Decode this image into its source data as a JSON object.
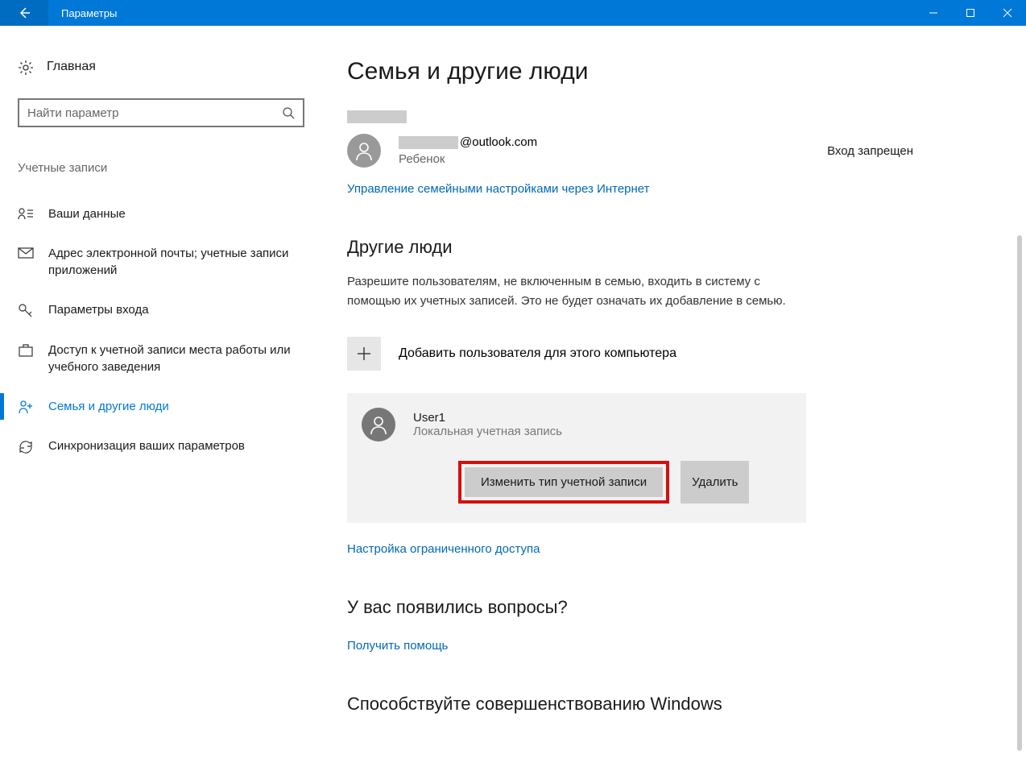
{
  "window": {
    "title": "Параметры"
  },
  "sidebar": {
    "home": "Главная",
    "search_placeholder": "Найти параметр",
    "section_label": "Учетные записи",
    "items": [
      {
        "label": "Ваши данные"
      },
      {
        "label": "Адрес электронной почты; учетные записи приложений"
      },
      {
        "label": "Параметры входа"
      },
      {
        "label": "Доступ к учетной записи места работы или учебного заведения"
      },
      {
        "label": "Семья и другие люди"
      },
      {
        "label": "Синхронизация ваших параметров"
      }
    ]
  },
  "main": {
    "page_title": "Семья и другие люди",
    "family_member": {
      "email_suffix": "@outlook.com",
      "role": "Ребенок",
      "status": "Вход запрещен"
    },
    "manage_link": "Управление семейными настройками через Интернет",
    "other_heading": "Другие люди",
    "other_desc": "Разрешите пользователям, не включенным в семью, входить в систему с помощью их учетных записей. Это не будет означать их добавление в семью.",
    "add_user": "Добавить пользователя для этого компьютера",
    "user": {
      "name": "User1",
      "type": "Локальная учетная запись",
      "change_btn": "Изменить тип учетной записи",
      "delete_btn": "Удалить"
    },
    "restricted_link": "Настройка ограниченного доступа",
    "questions_heading": "У вас появились вопросы?",
    "help_link": "Получить помощь",
    "feedback_heading": "Способствуйте совершенствованию Windows"
  }
}
